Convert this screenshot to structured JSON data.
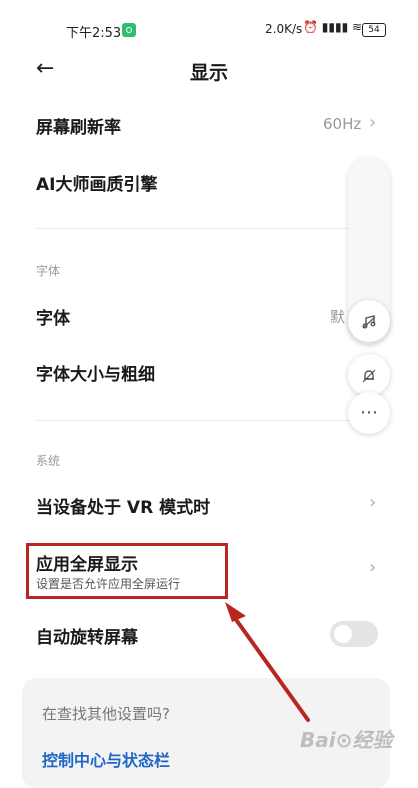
{
  "status_bar": {
    "time": "下午2:53",
    "net_speed": "2.0K/s",
    "icons": "⏰ ▮▮▮▮ ≋",
    "battery": "54"
  },
  "header": {
    "back_icon": "←",
    "title": "显示"
  },
  "display": {
    "refresh_rate_label": "屏幕刷新率",
    "refresh_rate_value": "60Hz",
    "ai_engine_label": "AI大师画质引擎"
  },
  "font_section": {
    "heading": "字体",
    "font_label": "字体",
    "font_value": "默",
    "font_size_label": "字体大小与粗细"
  },
  "system_section": {
    "heading": "系统",
    "vr_label": "当设备处于 VR 模式时",
    "fullscreen_label": "应用全屏显示",
    "fullscreen_sub": "设置是否允许应用全屏运行",
    "rotate_label": "自动旋转屏幕",
    "rotate_on": false
  },
  "search_card": {
    "prompt": "在查找其他设置吗?",
    "link": "控制中心与状态栏"
  },
  "floating": {
    "more": "⋯"
  },
  "watermark": "Bai⊙经验",
  "colors": {
    "highlight": "#b8261f",
    "link": "#1f66c9"
  },
  "chevron": "›"
}
